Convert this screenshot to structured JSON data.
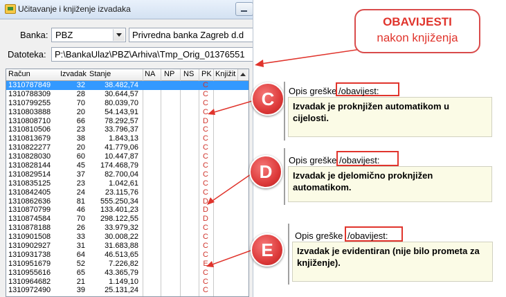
{
  "window": {
    "title": "Učitavanje i knjiženje izvadaka",
    "bank_label": "Banka:",
    "bank_code": "PBZ",
    "bank_name": "Privredna banka Zagreb d.d",
    "file_label": "Datoteka:",
    "file_path": "P:\\BankaUlaz\\PBZ\\Arhiva\\Tmp_Orig_01376551"
  },
  "grid": {
    "headers": [
      "Račun",
      "Izvadak",
      "Stanje",
      "NA",
      "NP",
      "NS",
      "PK",
      "Knjižit"
    ],
    "rows": [
      {
        "racun": "1310787849",
        "izvadak": "32",
        "stanje": "38.482,74",
        "pk": "C",
        "selected": true
      },
      {
        "racun": "1310788309",
        "izvadak": "28",
        "stanje": "30.644,57",
        "pk": "C"
      },
      {
        "racun": "1310799255",
        "izvadak": "70",
        "stanje": "80.039,70",
        "pk": "C"
      },
      {
        "racun": "1310803888",
        "izvadak": "20",
        "stanje": "54.143,91",
        "pk": "C"
      },
      {
        "racun": "1310808710",
        "izvadak": "66",
        "stanje": "78.292,57",
        "pk": "D"
      },
      {
        "racun": "1310810506",
        "izvadak": "23",
        "stanje": "33.796,37",
        "pk": "C"
      },
      {
        "racun": "1310813679",
        "izvadak": "38",
        "stanje": "1.843,13",
        "pk": "C"
      },
      {
        "racun": "1310822277",
        "izvadak": "20",
        "stanje": "41.779,06",
        "pk": "C"
      },
      {
        "racun": "1310828030",
        "izvadak": "60",
        "stanje": "10.447,87",
        "pk": "C"
      },
      {
        "racun": "1310828144",
        "izvadak": "45",
        "stanje": "174.468,79",
        "pk": "C"
      },
      {
        "racun": "1310829514",
        "izvadak": "37",
        "stanje": "82.700,04",
        "pk": "C"
      },
      {
        "racun": "1310835125",
        "izvadak": "23",
        "stanje": "1.042,61",
        "pk": "C"
      },
      {
        "racun": "1310842405",
        "izvadak": "24",
        "stanje": "23.115,76",
        "pk": "C"
      },
      {
        "racun": "1310862636",
        "izvadak": "81",
        "stanje": "555.250,34",
        "pk": "D"
      },
      {
        "racun": "1310870799",
        "izvadak": "46",
        "stanje": "133.401,23",
        "pk": "D"
      },
      {
        "racun": "1310874584",
        "izvadak": "70",
        "stanje": "298.122,55",
        "pk": "D"
      },
      {
        "racun": "1310878188",
        "izvadak": "26",
        "stanje": "33.979,32",
        "pk": "C"
      },
      {
        "racun": "1310901508",
        "izvadak": "33",
        "stanje": "30.008,22",
        "pk": "C"
      },
      {
        "racun": "1310902927",
        "izvadak": "31",
        "stanje": "31.683,88",
        "pk": "C"
      },
      {
        "racun": "1310931738",
        "izvadak": "64",
        "stanje": "46.513,65",
        "pk": "C"
      },
      {
        "racun": "1310951679",
        "izvadak": "52",
        "stanje": "7.226,82",
        "pk": "E"
      },
      {
        "racun": "1310955616",
        "izvadak": "65",
        "stanje": "43.365,79",
        "pk": "C"
      },
      {
        "racun": "1310964682",
        "izvadak": "21",
        "stanje": "1.149,10",
        "pk": "C"
      },
      {
        "racun": "1310972490",
        "izvadak": "39",
        "stanje": "25.131,24",
        "pk": "C"
      }
    ]
  },
  "callout": {
    "title": "OBAVIJESTI",
    "subtitle": "nakon knjiženja"
  },
  "markers": {
    "c": "C",
    "d": "D",
    "e": "E"
  },
  "panels": {
    "c": {
      "caption_prefix": "Opis greške",
      "caption_hl": "/obavijest:",
      "text": "Izvadak je proknjižen automatikom u cijelosti."
    },
    "d": {
      "caption_prefix": "Opis greške",
      "caption_hl": "/obavijest:",
      "text": "Izvadak je djelomično proknjižen automatikom."
    },
    "e": {
      "caption_prefix": "Opis greške",
      "caption_hl": "/obavijest:",
      "text": "Izvadak je evidentiran (nije bilo prometa za knjiženje)."
    }
  },
  "colors": {
    "accent_red": "#e0342c",
    "selection": "#3399ff",
    "note_bg": "#fbfbe6"
  }
}
